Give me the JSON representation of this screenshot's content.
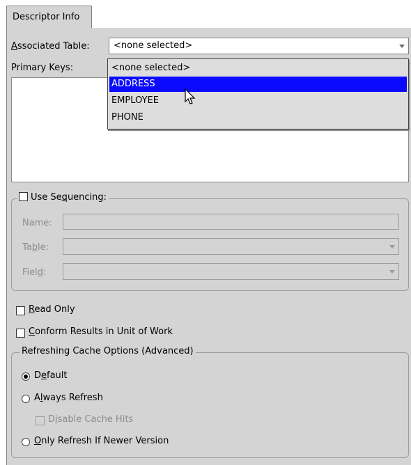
{
  "tab": {
    "label": "Descriptor Info"
  },
  "associated_table": {
    "label_prefix": "A",
    "label_rest": "ssociated Table:",
    "selected": "<none selected>",
    "options": [
      "<none selected>",
      "ADDRESS",
      "EMPLOYEE",
      "PHONE"
    ],
    "highlighted_option": "ADDRESS"
  },
  "primary_keys": {
    "label": "Primary Keys:"
  },
  "sequencing": {
    "checkbox_label_pre": "Use Se",
    "checkbox_label_u": "q",
    "checkbox_label_post": "uencing:",
    "checked": false,
    "name_label": "Name:",
    "table_label_pre": "Ta",
    "table_label_u": "b",
    "table_label_post": "le:",
    "field_label_pre": "Fiel",
    "field_label_u": "d",
    "field_label_post": ":"
  },
  "read_only": {
    "label_u": "R",
    "label_rest": "ead Only",
    "checked": false
  },
  "conform_results": {
    "label_u": "C",
    "label_rest": "onform Results in Unit of Work",
    "checked": false
  },
  "refreshing_cache": {
    "title": "Refreshing Cache Options (Advanced)",
    "default_pre": "D",
    "default_u": "e",
    "default_post": "fault",
    "always_pre": "A",
    "always_u": "l",
    "always_post": "ways Refresh",
    "disable_pre": "D",
    "disable_u": "i",
    "disable_post": "sable Cache Hits",
    "only_u": "O",
    "only_post": "nly Refresh If Newer Version",
    "selected": "Default"
  },
  "colors": {
    "panel": "#d4d4d4",
    "selection": "#0a0aff",
    "disabled_text": "#8c8c8c"
  }
}
